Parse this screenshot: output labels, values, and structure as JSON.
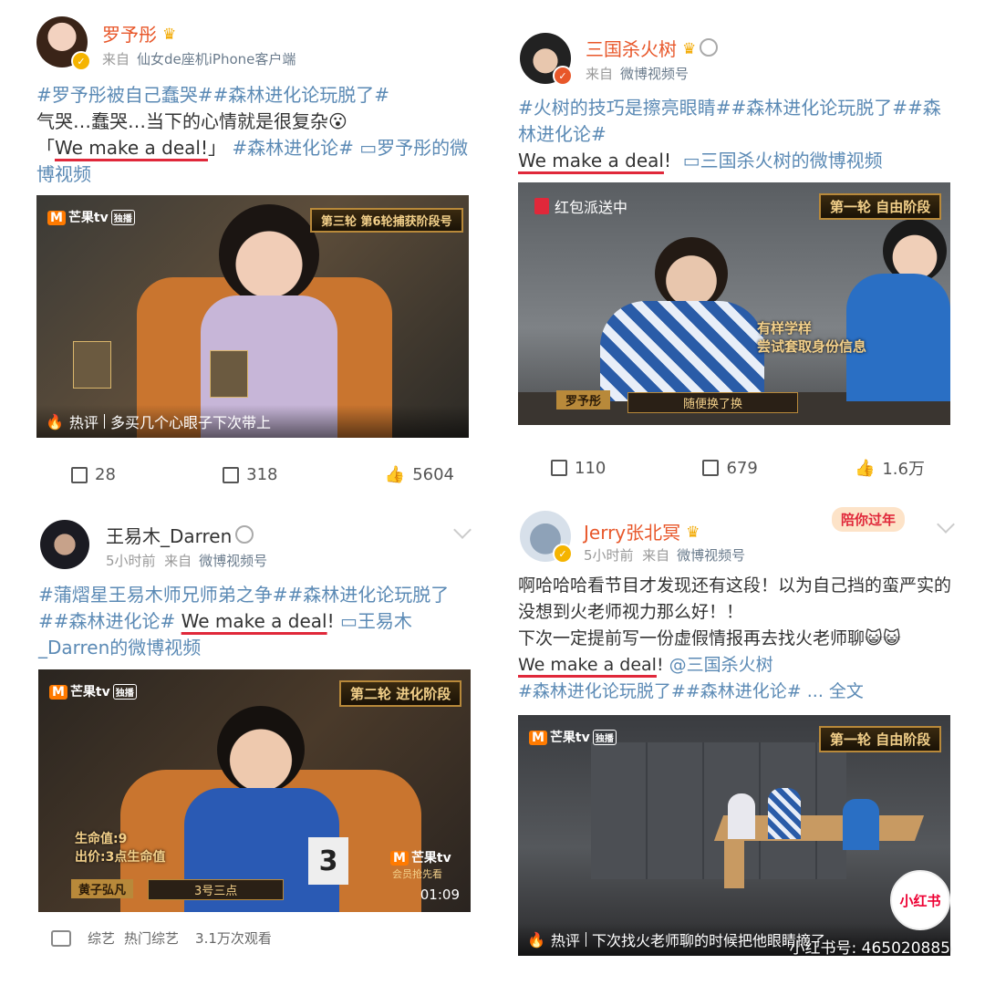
{
  "posts": [
    {
      "username": "罗予彤",
      "source_prefix": "来自",
      "source": "仙女de座机iPhone客户端",
      "text": {
        "tag1": "#罗予彤被自己蠢哭##森林进化论玩脱了#",
        "line2": "气哭…蠢哭…当下的心情就是很复杂",
        "quote_open": "「",
        "deal": "We make a deal!",
        "quote_close": "」",
        "tag2": "#森林进化论#",
        "video_link": "罗予彤的微博视频"
      },
      "video": {
        "brand": "芒果tv",
        "exclusive": "独播",
        "round": "第三轮 第6轮捕获阶段号",
        "hot_label": "热评",
        "hot_comment": "多买几个心眼子下次带上"
      },
      "stats": {
        "repost": "28",
        "comment": "318",
        "like": "5604"
      }
    },
    {
      "username": "三国杀火树",
      "source_prefix": "来自",
      "source": "微博视频号",
      "text": {
        "tag1": "#火树的技巧是擦亮眼睛##森林进化论玩脱了##森林进化论#",
        "deal": "We make a deal",
        "punct": "!",
        "video_link": "三国杀火树的微博视频"
      },
      "video": {
        "redpacket": "红包派送中",
        "round": "第一轮 自由阶段",
        "caption1": "有样学样",
        "caption2": "尝试套取身份信息",
        "nameplate": "罗予彤",
        "subtitle": "随便换了换"
      },
      "stats": {
        "repost": "110",
        "comment": "679",
        "like": "1.6万"
      }
    },
    {
      "username": "王易木_Darren",
      "time": "5小时前",
      "source_prefix": "来自",
      "source": "微博视频号",
      "text": {
        "tag1": "#蒲熠星王易木师兄师弟之争##森林进化论玩脱了##森林进化论#",
        "deal": "We make a deal",
        "punct": "!",
        "video_link": "王易木_Darren的微博视频"
      },
      "video": {
        "brand": "芒果tv",
        "exclusive": "独播",
        "round": "第二轮 进化阶段",
        "hp": "生命值:9",
        "bid": "出价:3点生命值",
        "nameplate": "黄子弘凡",
        "seat": "3号三点",
        "number": "3",
        "brand2": "芒果tv",
        "vip": "会员抢先看",
        "duration": "01:09"
      },
      "footer": {
        "cat1": "综艺",
        "cat2": "热门综艺",
        "views": "3.1万次观看"
      }
    },
    {
      "username": "Jerry张北冥",
      "badge": "陪你过年",
      "time": "5小时前",
      "source_prefix": "来自",
      "source": "微博视频号",
      "text": {
        "line1": "啊哈哈哈看节目才发现还有这段！以为自己挡的蛮严实的没想到火老师视力那么好！！",
        "line2": "下次一定提前写一份虚假情报再去找火老师聊",
        "deal": "We make a deal",
        "punct": "!",
        "mention": "@三国杀火树",
        "tags": "#森林进化论玩脱了##森林进化论#",
        "more": "... 全文"
      },
      "video": {
        "brand": "芒果tv",
        "exclusive": "独播",
        "round": "第一轮 自由阶段",
        "hot_label": "热评",
        "hot_comment": "下次找火老师聊的时候把他眼睛摘了"
      }
    }
  ],
  "watermark": {
    "app": "小红书",
    "id": "小红书号: 465020885"
  },
  "colors": {
    "brand_orange": "#e8572a",
    "tag_blue": "#5b8ab5",
    "underline_red": "#e0283a"
  }
}
